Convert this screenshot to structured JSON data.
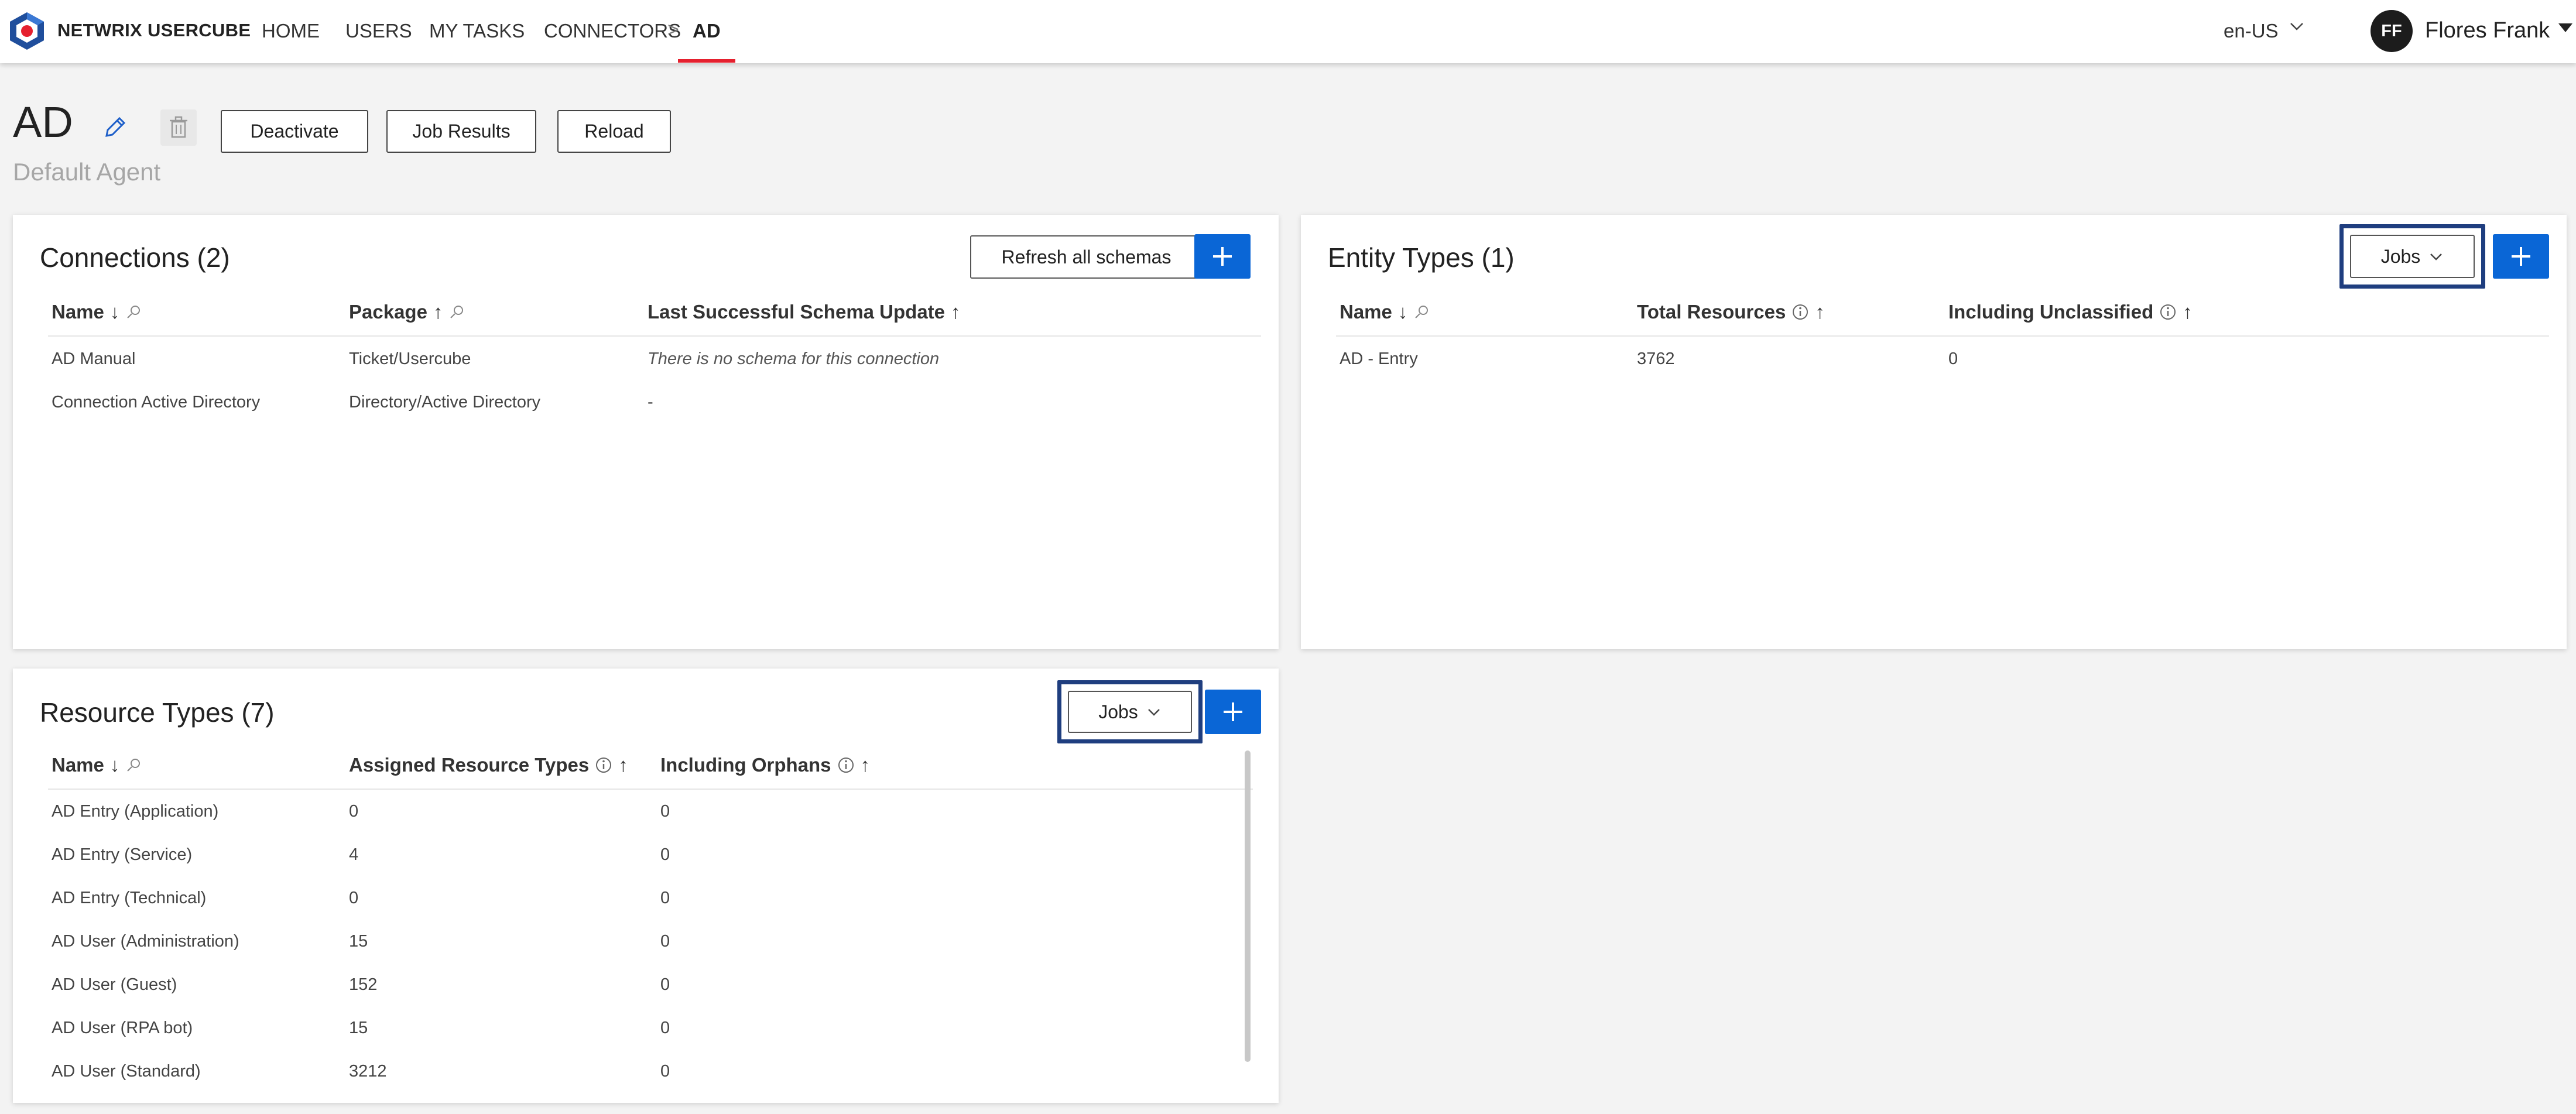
{
  "header": {
    "brand": "NETWRIX USERCUBE",
    "nav": [
      "HOME",
      "USERS",
      "MY TASKS",
      "CONNECTORS"
    ],
    "breadcrumb_separator": ">",
    "breadcrumb_current": "AD",
    "language": "en-US",
    "user_initials": "FF",
    "user_name": "Flores Frank",
    "colors": {
      "accent": "#e5202e",
      "primary": "#0a66d6",
      "highlight": "#1f3e7f"
    }
  },
  "page": {
    "title": "AD",
    "subtitle": "Default Agent",
    "buttons": {
      "deactivate": "Deactivate",
      "job_results": "Job Results",
      "reload": "Reload"
    }
  },
  "connections": {
    "title": "Connections (2)",
    "refresh_label": "Refresh all schemas",
    "columns": {
      "name": "Name",
      "package": "Package",
      "last_update": "Last Successful Schema Update"
    },
    "rows": [
      {
        "name": "AD Manual",
        "package": "Ticket/Usercube",
        "last_update": "There is no schema for this connection"
      },
      {
        "name": "Connection Active Directory",
        "package": "Directory/Active Directory",
        "last_update": "-"
      }
    ]
  },
  "entity_types": {
    "title": "Entity Types (1)",
    "jobs_label": "Jobs",
    "columns": {
      "name": "Name",
      "total": "Total Resources",
      "unclassified": "Including Unclassified"
    },
    "rows": [
      {
        "name": "AD - Entry",
        "total": "3762",
        "unclassified": "0"
      }
    ]
  },
  "resource_types": {
    "title": "Resource Types (7)",
    "jobs_label": "Jobs",
    "columns": {
      "name": "Name",
      "assigned": "Assigned Resource Types",
      "orphans": "Including Orphans"
    },
    "rows": [
      {
        "name": "AD Entry (Application)",
        "assigned": "0",
        "orphans": "0"
      },
      {
        "name": "AD Entry (Service)",
        "assigned": "4",
        "orphans": "0"
      },
      {
        "name": "AD Entry (Technical)",
        "assigned": "0",
        "orphans": "0"
      },
      {
        "name": "AD User (Administration)",
        "assigned": "15",
        "orphans": "0"
      },
      {
        "name": "AD User (Guest)",
        "assigned": "152",
        "orphans": "0"
      },
      {
        "name": "AD User (RPA bot)",
        "assigned": "15",
        "orphans": "0"
      },
      {
        "name": "AD User (Standard)",
        "assigned": "3212",
        "orphans": "0"
      }
    ]
  }
}
